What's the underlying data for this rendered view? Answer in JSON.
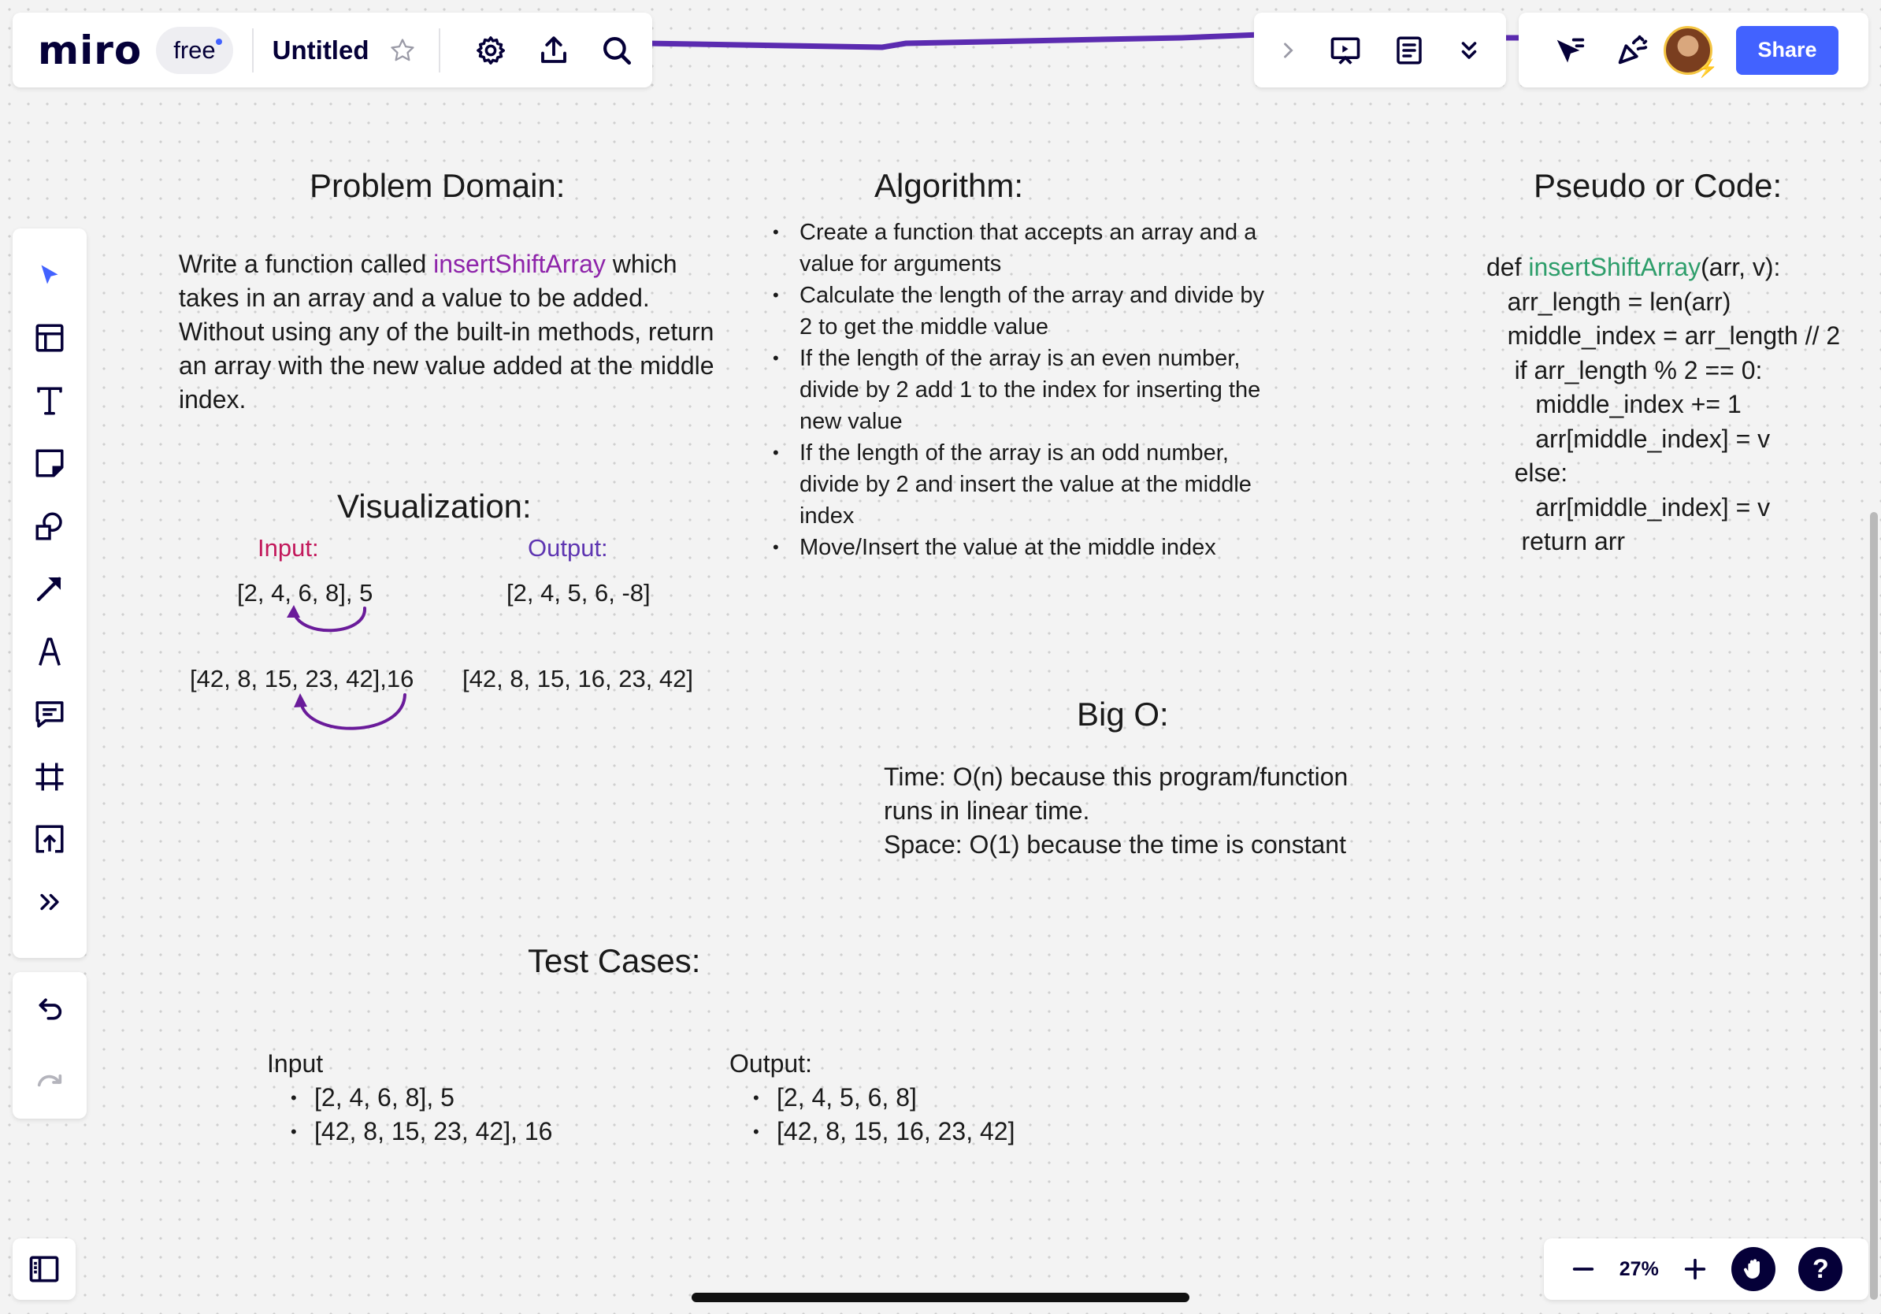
{
  "app": {
    "logo": "miro",
    "plan": "free",
    "board_title": "Untitled"
  },
  "topbar": {
    "left_icons": [
      "star-icon",
      "gear-icon",
      "upload-icon",
      "search-icon"
    ],
    "mid_icons": [
      "chevron-right-icon",
      "presentation-icon",
      "notes-icon",
      "chevrons-down-icon"
    ],
    "right_icons": [
      "cursor-icon",
      "celebrate-icon"
    ],
    "share_label": "Share"
  },
  "toolbar": {
    "tools": [
      "select",
      "templates",
      "text",
      "sticky-note",
      "shapes",
      "arrow",
      "pen",
      "comment",
      "frame",
      "upload",
      "more"
    ],
    "undo": "undo-icon",
    "redo": "redo-icon"
  },
  "zoom": {
    "level": "27%"
  },
  "colors": {
    "accent": "#4262ff",
    "connector": "#5b2bb0",
    "function_name_purple": "#8e24aa",
    "function_name_green": "#2e9e6b",
    "input_label": "#c2185b",
    "output_label": "#5e35b1"
  },
  "board": {
    "problem_domain": {
      "heading": "Problem Domain:",
      "text_before": "Write a function called ",
      "fn_name": "insertShiftArray",
      "text_after": " which takes in an array and a value to be added. Without using any of the built-in methods, return an array with the new value added at the middle index."
    },
    "algorithm": {
      "heading": "Algorithm:",
      "steps": [
        "Create a function that accepts an array and a value for arguments",
        "Calculate the length of the array and divide by 2 to get the middle value",
        "If the length of the array is an even number, divide by 2 add 1 to the index for inserting the new value",
        "If the length of the array is an odd number, divide by 2 and insert the value at the middle index",
        "Move/Insert the value at the middle index"
      ]
    },
    "code": {
      "heading": "Pseudo or Code:",
      "def_prefix": "def ",
      "fn_name": "insertShiftArray",
      "def_suffix": "(arr, v):",
      "lines": [
        "   arr_length = len(arr)",
        "   middle_index = arr_length // 2",
        "    if arr_length % 2 == 0:",
        "       middle_index += 1",
        "       arr[middle_index] = v",
        "    else:",
        "       arr[middle_index] = v",
        "     return arr"
      ]
    },
    "visualization": {
      "heading": "Visualization:",
      "input_label": "Input:",
      "output_label": "Output:",
      "input_1": "[2, 4, 6, 8], 5",
      "output_1": "[2, 4, 5, 6, -8]",
      "input_2": "[42, 8, 15, 23, 42],16",
      "output_2": "[42, 8, 15, 16, 23, 42]"
    },
    "big_o": {
      "heading": "Big O:",
      "lines": [
        "Time: O(n) because this program/function",
        "runs in linear time.",
        "Space: O(1) because the time is constant"
      ]
    },
    "test_cases": {
      "heading": "Test Cases:",
      "input_label": "Input",
      "inputs": [
        "[2, 4, 6, 8], 5",
        "[42, 8, 15, 23, 42], 16"
      ],
      "output_label": "Output:",
      "outputs": [
        "[2, 4, 5, 6, 8]",
        "[42, 8, 15, 16, 23, 42]"
      ]
    }
  }
}
